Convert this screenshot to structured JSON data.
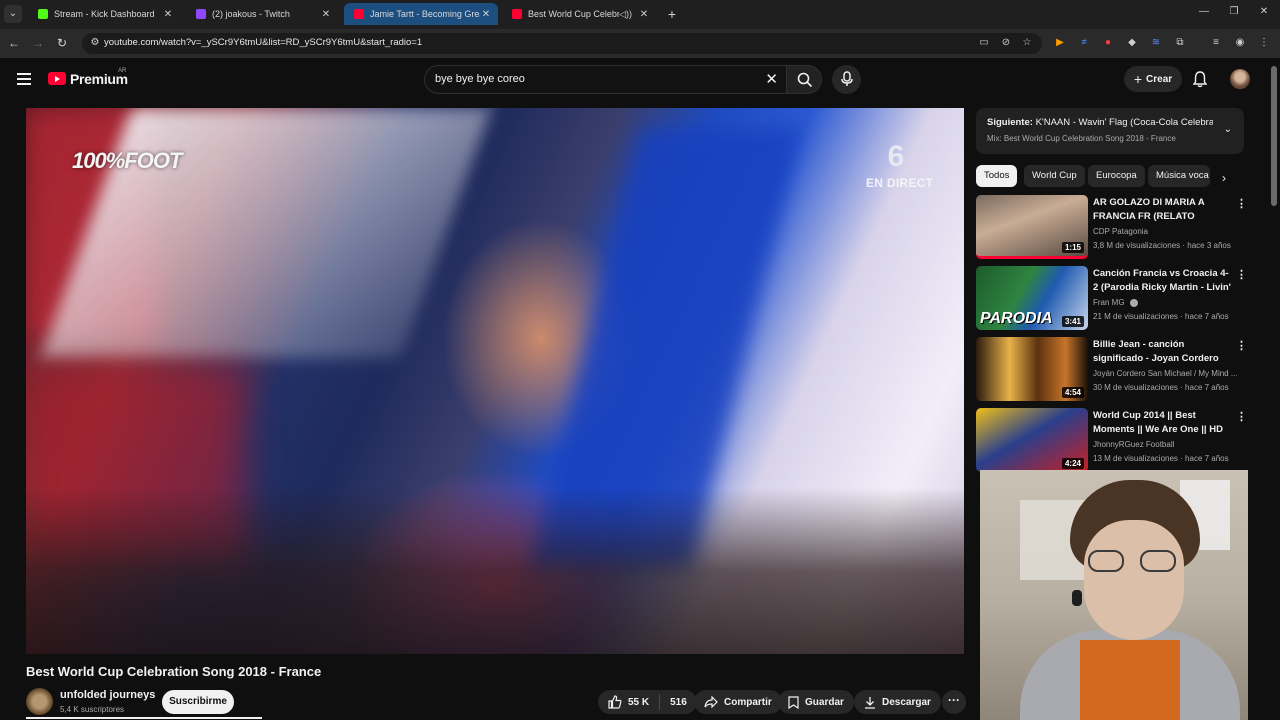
{
  "browser": {
    "tabs": [
      {
        "title": "Stream - Kick Dashboard",
        "favicon_color": "#53fc18"
      },
      {
        "title": "(2) joakous - Twitch",
        "favicon_color": "#9146ff"
      },
      {
        "title": "Jamie Tartt - Becoming Great",
        "favicon_color": "#ff0033"
      },
      {
        "title": "Best World Cup Celebration",
        "favicon_color": "#ff0033"
      }
    ],
    "url": "youtube.com/watch?v=_ySCr9Y6tmU&list=RD_ySCr9Y6tmU&start_radio=1"
  },
  "masthead": {
    "logo_text": "Premium",
    "country": "AR",
    "search_value": "bye bye bye coreo",
    "create_label": "Crear"
  },
  "player": {
    "logo_overlay": "100%FOOT",
    "channel_logo": "6",
    "live_label": "EN DIRECT"
  },
  "video": {
    "title": "Best World Cup Celebration Song 2018 - France",
    "channel": "unfolded journeys",
    "subscribers": "5,4 K suscriptores",
    "subscribe_label": "Suscribirme",
    "likes": "55 K",
    "comments": "516",
    "share_label": "Compartir",
    "save_label": "Guardar",
    "download_label": "Descargar"
  },
  "up_next": {
    "prefix": "Siguiente:",
    "title": "K'NAAN - Wavin' Flag (Coca-Cola Celebra...",
    "mix": "Mix: Best World Cup Celebration Song 2018 - France"
  },
  "chips": [
    "Todos",
    "World Cup",
    "Eurocopa",
    "Música voca"
  ],
  "recommendations": [
    {
      "title": "AR GOLAZO DI MARIA A FRANCIA FR (RELATO MARIAN...",
      "channel": "CDP Patagonia",
      "meta": "3,8 M de visualizaciones · hace 3 años",
      "duration": "1:15"
    },
    {
      "title": "Canción Francia vs Croacia 4-2 (Parodia Ricky Martin - Livin' L...",
      "channel": "Fran MG",
      "meta": "21 M de visualizaciones · hace 7 años",
      "duration": "3:41",
      "overlay": "PARODIA"
    },
    {
      "title": "Billie Jean - canción significado - Joyan Cordero",
      "channel": "Joyán Cordero San Michael / My Mind ...",
      "meta": "30 M de visualizaciones · hace 7 años",
      "duration": "4:54"
    },
    {
      "title": "World Cup 2014 || Best Moments || We Are One || HD",
      "channel": "JhonnyRGuez Football",
      "meta": "13 M de visualizaciones · hace 7 años",
      "duration": "4:24"
    }
  ],
  "colors": {
    "brand": "#ff0033",
    "background": "#0f0f0f",
    "active_tab": "#1d4e80"
  }
}
